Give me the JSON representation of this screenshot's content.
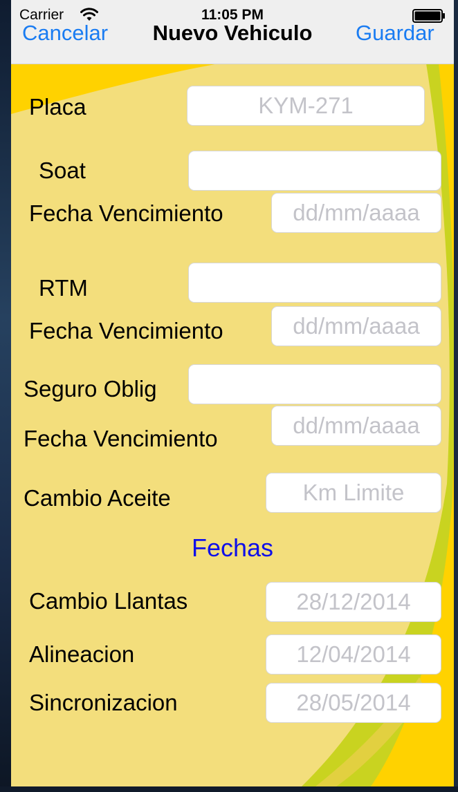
{
  "status_bar": {
    "carrier": "Carrier",
    "time": "11:05 PM"
  },
  "nav_bar": {
    "cancel_label": "Cancelar",
    "title": "Nuevo Vehiculo",
    "save_label": "Guardar"
  },
  "form": {
    "placa": {
      "label": "Placa",
      "placeholder": "KYM-271",
      "value": ""
    },
    "soat": {
      "label": "Soat",
      "value": "",
      "date_label": "Fecha Vencimiento",
      "date_placeholder": "dd/mm/aaaa"
    },
    "rtm": {
      "label": "RTM",
      "value": "",
      "date_label": "Fecha Vencimiento",
      "date_placeholder": "dd/mm/aaaa"
    },
    "seguro": {
      "label": "Seguro Oblig",
      "value": "",
      "date_label": "Fecha Vencimiento",
      "date_placeholder": "dd/mm/aaaa"
    },
    "aceite": {
      "label": "Cambio Aceite",
      "placeholder": "Km Limite"
    },
    "fechas_title": "Fechas",
    "llantas": {
      "label": "Cambio Llantas",
      "placeholder": "28/12/2014"
    },
    "alineacion": {
      "label": "Alineacion",
      "placeholder": "12/04/2014"
    },
    "sincronizacion": {
      "label": "Sincronizacion",
      "placeholder": "28/05/2014"
    }
  },
  "colors": {
    "background": "#f3de7c",
    "nav_bar": "#efefef",
    "link_blue": "#1a7cf2",
    "section_title_blue": "#1010e8",
    "accent_green": "#c9d320",
    "accent_yellow": "#ffd200"
  },
  "icons": {
    "wifi": "wifi-icon",
    "battery": "battery-icon"
  }
}
